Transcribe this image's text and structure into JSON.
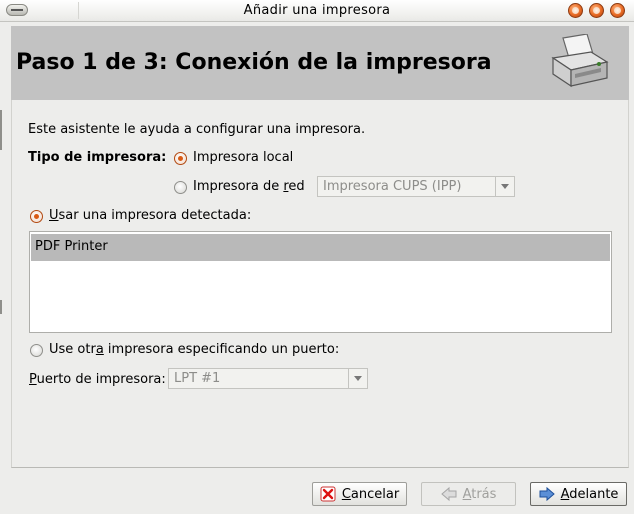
{
  "window": {
    "title": "Añadir una impresora"
  },
  "header": {
    "title": "Paso 1 de 3: Conexión de la impresora"
  },
  "intro": {
    "text": "Este asistente le ayuda a configurar una impresora."
  },
  "printer_type": {
    "label": "Tipo de impresora:",
    "local_label": "Impresora local",
    "network_prefix": "Impresora de ",
    "network_mnemonic": "r",
    "network_suffix": "ed",
    "network_protocol": "Impresora CUPS (IPP)",
    "selected": "local"
  },
  "detected": {
    "prefix": "",
    "mnemonic": "U",
    "suffix": "sar una impresora detectada:",
    "selected": true,
    "printers": [
      "PDF Printer"
    ]
  },
  "other_port": {
    "prefix": "Use otr",
    "mnemonic": "a",
    "suffix": " impresora especificando un puerto:",
    "selected": false
  },
  "port": {
    "mnemonic": "P",
    "label_rest": "uerto de impresora:",
    "value": "LPT #1"
  },
  "buttons": {
    "cancel_mnemonic": "C",
    "cancel_rest": "ancelar",
    "back_mnemonic": "A",
    "back_rest": "trás",
    "forward_mnemonic": "A",
    "forward_rest": "delante"
  },
  "colors": {
    "accent_radio": "#d95a14",
    "header_bg": "#c2c2c2",
    "selection_bg": "#b9b9b9"
  }
}
